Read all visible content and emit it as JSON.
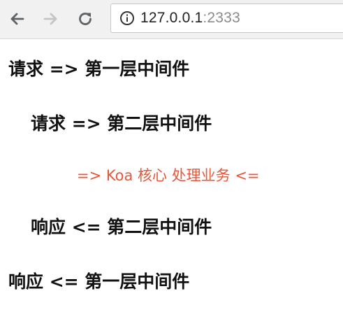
{
  "browser": {
    "url_host": "127.0.0.1",
    "url_port": ":2333",
    "accent_text_color": "#e8573a"
  },
  "page": {
    "lines": [
      "请求 => 第一层中间件",
      "请求 => 第二层中间件",
      "=> Koa 核心 处理业务 <=",
      "响应 <= 第二层中间件",
      "响应 <= 第一层中间件"
    ]
  }
}
